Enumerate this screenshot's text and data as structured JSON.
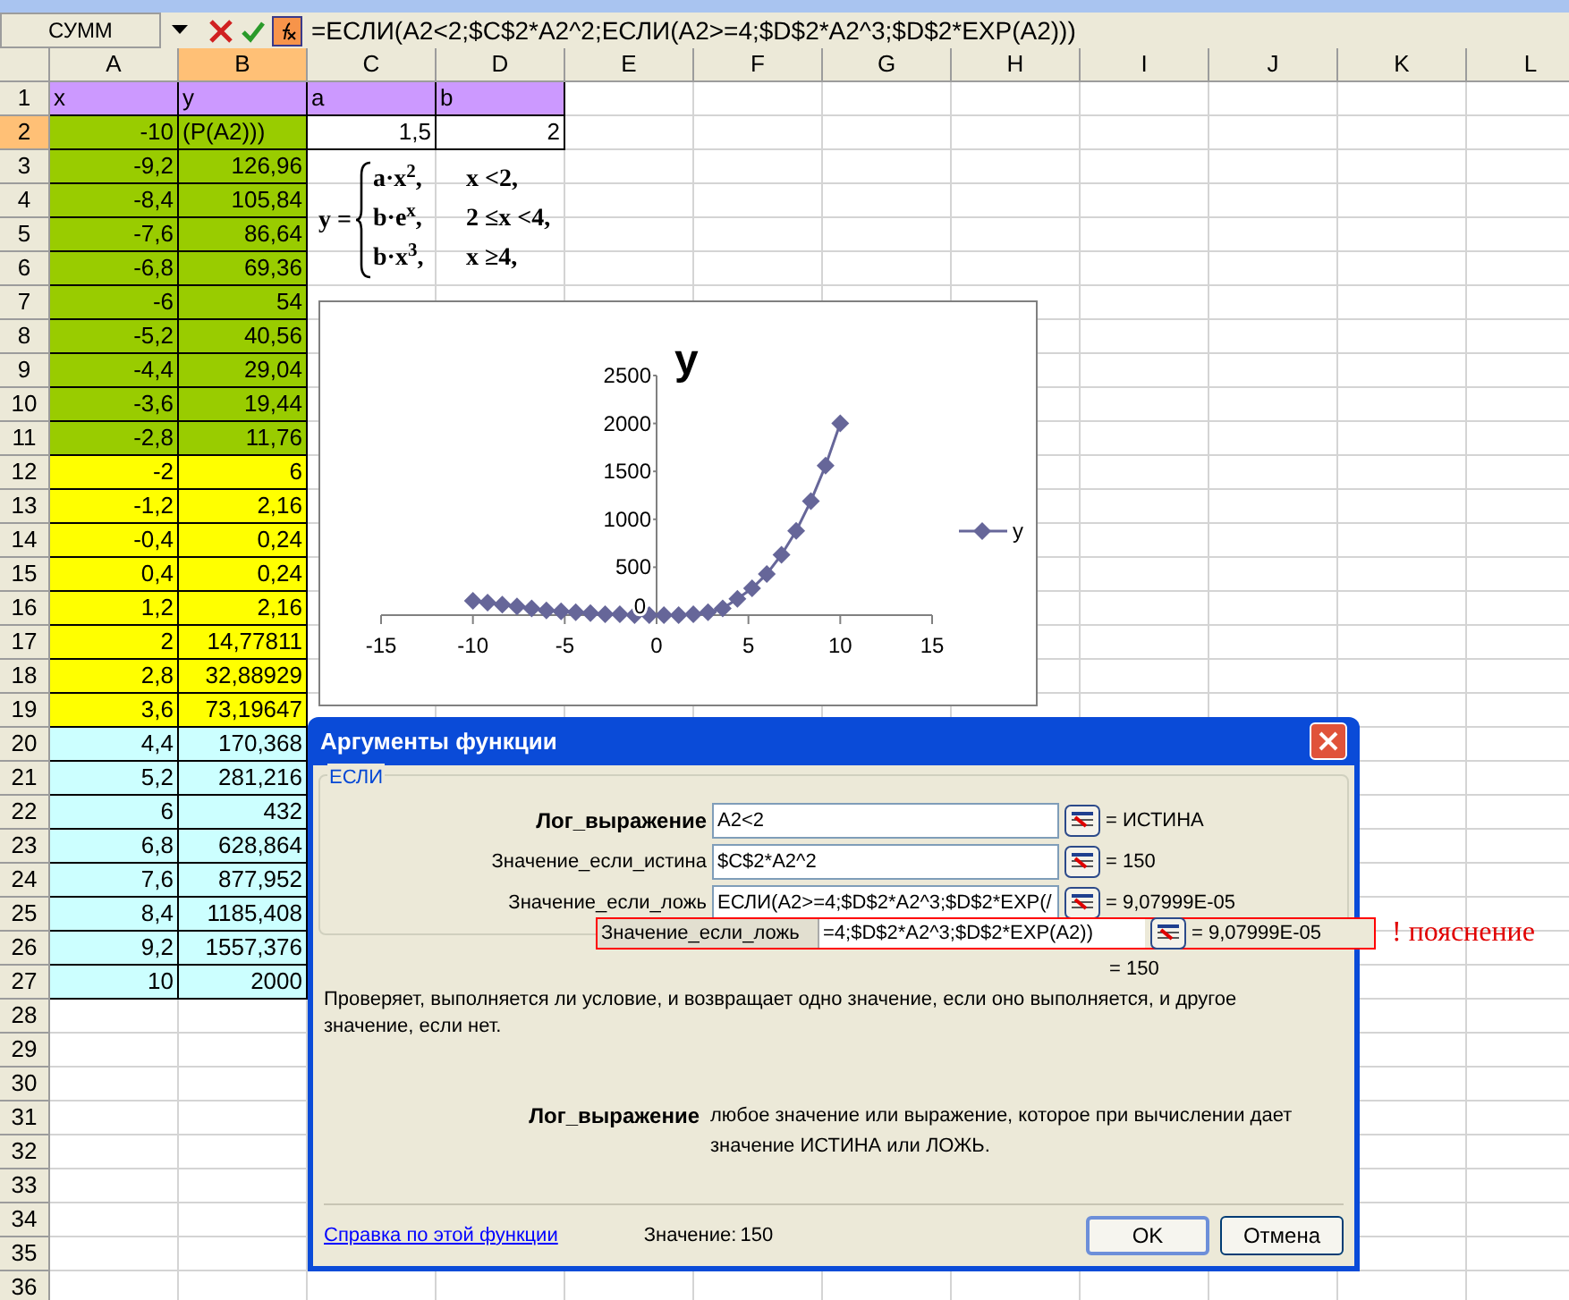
{
  "formula_bar": {
    "name_box": "СУММ",
    "formula": "=ЕСЛИ(A2<2;$C$2*A2^2;ЕСЛИ(A2>=4;$D$2*A2^3;$D$2*EXP(A2)))"
  },
  "columns": [
    {
      "label": "A",
      "selected": false
    },
    {
      "label": "B",
      "selected": true
    },
    {
      "label": "C",
      "selected": false
    },
    {
      "label": "D",
      "selected": false
    },
    {
      "label": "E",
      "selected": false
    },
    {
      "label": "F",
      "selected": false
    },
    {
      "label": "G",
      "selected": false
    },
    {
      "label": "H",
      "selected": false
    },
    {
      "label": "I",
      "selected": false
    },
    {
      "label": "J",
      "selected": false
    },
    {
      "label": "K",
      "selected": false
    },
    {
      "label": "L",
      "selected": false
    }
  ],
  "rows": [
    {
      "label": "1",
      "selected": false,
      "cells": [
        {
          "text": "x",
          "kind": "text",
          "color": "#cc99ff"
        },
        {
          "text": "y",
          "kind": "text",
          "color": "#cc99ff"
        },
        {
          "text": "a",
          "kind": "text",
          "color": "#cc99ff"
        },
        {
          "text": "b",
          "kind": "text",
          "color": "#cc99ff"
        }
      ]
    },
    {
      "label": "2",
      "selected": true,
      "cells": [
        {
          "text": "-10",
          "kind": "number",
          "color": "#99cc00"
        },
        {
          "text": "(P(A2)))",
          "kind": "text",
          "color": "#99cc00"
        },
        {
          "text": "1,5",
          "kind": "number",
          "color": "#ffffff"
        },
        {
          "text": "2",
          "kind": "number",
          "color": "#ffffff"
        }
      ]
    },
    {
      "label": "3",
      "selected": false,
      "cells": [
        {
          "text": "-9,2",
          "kind": "number",
          "color": "#99cc00"
        },
        {
          "text": "126,96",
          "kind": "number",
          "color": "#99cc00"
        }
      ]
    },
    {
      "label": "4",
      "selected": false,
      "cells": [
        {
          "text": "-8,4",
          "kind": "number",
          "color": "#99cc00"
        },
        {
          "text": "105,84",
          "kind": "number",
          "color": "#99cc00"
        }
      ]
    },
    {
      "label": "5",
      "selected": false,
      "cells": [
        {
          "text": "-7,6",
          "kind": "number",
          "color": "#99cc00"
        },
        {
          "text": "86,64",
          "kind": "number",
          "color": "#99cc00"
        }
      ]
    },
    {
      "label": "6",
      "selected": false,
      "cells": [
        {
          "text": "-6,8",
          "kind": "number",
          "color": "#99cc00"
        },
        {
          "text": "69,36",
          "kind": "number",
          "color": "#99cc00"
        }
      ]
    },
    {
      "label": "7",
      "selected": false,
      "cells": [
        {
          "text": "-6",
          "kind": "number",
          "color": "#99cc00"
        },
        {
          "text": "54",
          "kind": "number",
          "color": "#99cc00"
        }
      ]
    },
    {
      "label": "8",
      "selected": false,
      "cells": [
        {
          "text": "-5,2",
          "kind": "number",
          "color": "#99cc00"
        },
        {
          "text": "40,56",
          "kind": "number",
          "color": "#99cc00"
        }
      ]
    },
    {
      "label": "9",
      "selected": false,
      "cells": [
        {
          "text": "-4,4",
          "kind": "number",
          "color": "#99cc00"
        },
        {
          "text": "29,04",
          "kind": "number",
          "color": "#99cc00"
        }
      ]
    },
    {
      "label": "10",
      "selected": false,
      "cells": [
        {
          "text": "-3,6",
          "kind": "number",
          "color": "#99cc00"
        },
        {
          "text": "19,44",
          "kind": "number",
          "color": "#99cc00"
        }
      ]
    },
    {
      "label": "11",
      "selected": false,
      "cells": [
        {
          "text": "-2,8",
          "kind": "number",
          "color": "#99cc00"
        },
        {
          "text": "11,76",
          "kind": "number",
          "color": "#99cc00"
        }
      ]
    },
    {
      "label": "12",
      "selected": false,
      "cells": [
        {
          "text": "-2",
          "kind": "number",
          "color": "#ffff00"
        },
        {
          "text": "6",
          "kind": "number",
          "color": "#ffff00"
        }
      ]
    },
    {
      "label": "13",
      "selected": false,
      "cells": [
        {
          "text": "-1,2",
          "kind": "number",
          "color": "#ffff00"
        },
        {
          "text": "2,16",
          "kind": "number",
          "color": "#ffff00"
        }
      ]
    },
    {
      "label": "14",
      "selected": false,
      "cells": [
        {
          "text": "-0,4",
          "kind": "number",
          "color": "#ffff00"
        },
        {
          "text": "0,24",
          "kind": "number",
          "color": "#ffff00"
        }
      ]
    },
    {
      "label": "15",
      "selected": false,
      "cells": [
        {
          "text": "0,4",
          "kind": "number",
          "color": "#ffff00"
        },
        {
          "text": "0,24",
          "kind": "number",
          "color": "#ffff00"
        }
      ]
    },
    {
      "label": "16",
      "selected": false,
      "cells": [
        {
          "text": "1,2",
          "kind": "number",
          "color": "#ffff00"
        },
        {
          "text": "2,16",
          "kind": "number",
          "color": "#ffff00"
        }
      ]
    },
    {
      "label": "17",
      "selected": false,
      "cells": [
        {
          "text": "2",
          "kind": "number",
          "color": "#ffff00"
        },
        {
          "text": "14,77811",
          "kind": "number",
          "color": "#ffff00"
        }
      ]
    },
    {
      "label": "18",
      "selected": false,
      "cells": [
        {
          "text": "2,8",
          "kind": "number",
          "color": "#ffff00"
        },
        {
          "text": "32,88929",
          "kind": "number",
          "color": "#ffff00"
        }
      ]
    },
    {
      "label": "19",
      "selected": false,
      "cells": [
        {
          "text": "3,6",
          "kind": "number",
          "color": "#ffff00"
        },
        {
          "text": "73,19647",
          "kind": "number",
          "color": "#ffff00"
        }
      ]
    },
    {
      "label": "20",
      "selected": false,
      "cells": [
        {
          "text": "4,4",
          "kind": "number",
          "color": "#ccffff"
        },
        {
          "text": "170,368",
          "kind": "number",
          "color": "#ccffff"
        }
      ]
    },
    {
      "label": "21",
      "selected": false,
      "cells": [
        {
          "text": "5,2",
          "kind": "number",
          "color": "#ccffff"
        },
        {
          "text": "281,216",
          "kind": "number",
          "color": "#ccffff"
        }
      ]
    },
    {
      "label": "22",
      "selected": false,
      "cells": [
        {
          "text": "6",
          "kind": "number",
          "color": "#ccffff"
        },
        {
          "text": "432",
          "kind": "number",
          "color": "#ccffff"
        }
      ]
    },
    {
      "label": "23",
      "selected": false,
      "cells": [
        {
          "text": "6,8",
          "kind": "number",
          "color": "#ccffff"
        },
        {
          "text": "628,864",
          "kind": "number",
          "color": "#ccffff"
        }
      ]
    },
    {
      "label": "24",
      "selected": false,
      "cells": [
        {
          "text": "7,6",
          "kind": "number",
          "color": "#ccffff"
        },
        {
          "text": "877,952",
          "kind": "number",
          "color": "#ccffff"
        }
      ]
    },
    {
      "label": "25",
      "selected": false,
      "cells": [
        {
          "text": "8,4",
          "kind": "number",
          "color": "#ccffff"
        },
        {
          "text": "1185,408",
          "kind": "number",
          "color": "#ccffff"
        }
      ]
    },
    {
      "label": "26",
      "selected": false,
      "cells": [
        {
          "text": "9,2",
          "kind": "number",
          "color": "#ccffff"
        },
        {
          "text": "1557,376",
          "kind": "number",
          "color": "#ccffff"
        }
      ]
    },
    {
      "label": "27",
      "selected": false,
      "cells": [
        {
          "text": "10",
          "kind": "number",
          "color": "#ccffff"
        },
        {
          "text": "2000",
          "kind": "number",
          "color": "#ccffff"
        }
      ]
    },
    {
      "label": "28",
      "selected": false
    },
    {
      "label": "29",
      "selected": false
    },
    {
      "label": "30",
      "selected": false
    },
    {
      "label": "31",
      "selected": false
    },
    {
      "label": "32",
      "selected": false
    },
    {
      "label": "33",
      "selected": false
    },
    {
      "label": "34",
      "selected": false
    },
    {
      "label": "35",
      "selected": false
    },
    {
      "label": "36",
      "selected": false
    }
  ],
  "equation": {
    "lhs": "y =",
    "cases": [
      {
        "expression": "a·x$^{2}$,",
        "condition": "x <2,"
      },
      {
        "expression": "b·e$^{x}$,",
        "condition": "2 ≤x <4,"
      },
      {
        "expression": "b·x$^{3}$,",
        "condition": "x ≥4,"
      }
    ]
  },
  "chart": {
    "chart_data": {
      "type": "line",
      "title": "y",
      "x": [
        -10,
        -9.2,
        -8.4,
        -7.6,
        -6.8,
        -6,
        -5.2,
        -4.4,
        -3.6,
        -2.8,
        -2,
        -1.2,
        -0.4,
        0.4,
        1.2,
        2,
        2.8,
        3.6,
        4.4,
        5.2,
        6,
        6.8,
        7.6,
        8.4,
        9.2,
        10
      ],
      "series": [
        {
          "name": "y",
          "color": "#666699",
          "marker": "diamond",
          "values": [
            150,
            130,
            110,
            90,
            70,
            50,
            40,
            30,
            20,
            10,
            10,
            0,
            0,
            0,
            0,
            10,
            30,
            70,
            170,
            280,
            430,
            630,
            880,
            1190,
            1560,
            2000
          ]
        }
      ],
      "xlim": [
        -15,
        15
      ],
      "ylim": [
        0,
        2500
      ],
      "xticks": [
        -15,
        -10,
        -5,
        0,
        5,
        10,
        15
      ],
      "yticks": [
        0,
        500,
        1000,
        1500,
        2000,
        2500
      ]
    }
  },
  "dialog": {
    "title": "Аргументы функции",
    "function_name": "ЕСЛИ",
    "arguments": [
      {
        "label": "Лог_выражение",
        "value": "A2<2",
        "result": "= ИСТИНА",
        "selected": true
      },
      {
        "label": "Значение_если_истина",
        "value": "$C$2*A2^2",
        "result": "= 150",
        "selected": false
      },
      {
        "label": "Значение_если_ложь",
        "value": "ЕСЛИ(A2>=4;$D$2*A2^3;$D$2*EXP(/",
        "result": "= 9,07999E-05",
        "selected": false
      }
    ],
    "callout": {
      "label": "Значение_если_ложь",
      "value": "=4;$D$2*A2^3;$D$2*EXP(A2))",
      "result": "= 9,07999E-05",
      "note": "! пояснение"
    },
    "formula_result": "= 150",
    "description": "Проверяет, выполняется ли условие, и возвращает одно значение, если оно выполняется, и другое значение, если нет.",
    "help_argument": "Лог_выражение",
    "help_text": "любое значение или выражение, которое при вычислении дает значение ИСТИНА или ЛОЖЬ.",
    "help_link": "Справка по этой функции",
    "value_label": "Значение:",
    "value": "150",
    "buttons": [
      {
        "label": "OK",
        "default": true
      },
      {
        "label": "Отмена",
        "default": false
      }
    ]
  }
}
